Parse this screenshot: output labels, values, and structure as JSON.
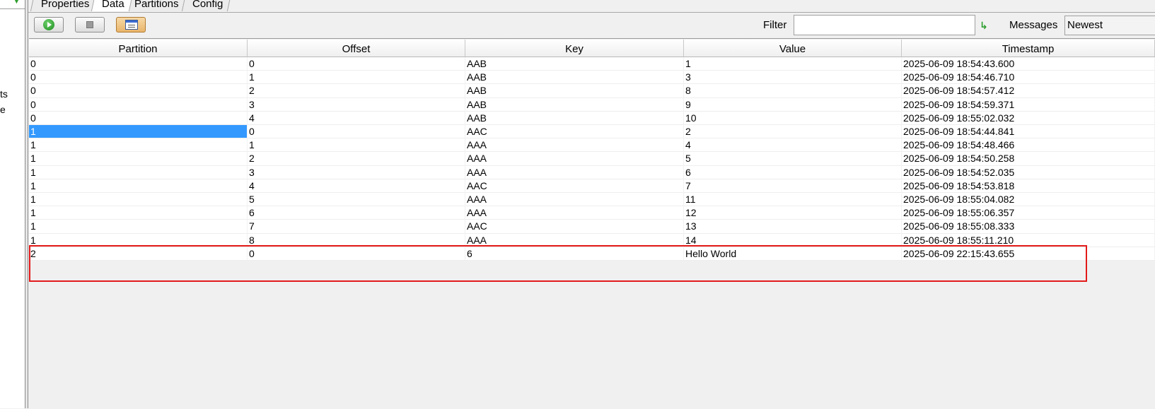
{
  "left_panel": {
    "fragments": [
      "ts",
      "e"
    ],
    "arrow_icon": "green-down-arrow-icon"
  },
  "tabs": [
    {
      "label": "Properties",
      "active": false
    },
    {
      "label": "Data",
      "active": true
    },
    {
      "label": "Partitions",
      "active": false
    },
    {
      "label": "Config",
      "active": false
    }
  ],
  "toolbar": {
    "start_icon": "play-icon",
    "stop_icon": "stop-icon",
    "view_icon": "window-icon",
    "filter_label": "Filter",
    "filter_value": "",
    "filter_apply_icon": "green-arrow-icon",
    "messages_label": "Messages",
    "messages_option": "Newest"
  },
  "table": {
    "columns": [
      "Partition",
      "Offset",
      "Key",
      "Value",
      "Timestamp"
    ],
    "rows": [
      [
        "0",
        "0",
        "AAB",
        "1",
        "2025-06-09 18:54:43.600"
      ],
      [
        "0",
        "1",
        "AAB",
        "3",
        "2025-06-09 18:54:46.710"
      ],
      [
        "0",
        "2",
        "AAB",
        "8",
        "2025-06-09 18:54:57.412"
      ],
      [
        "0",
        "3",
        "AAB",
        "9",
        "2025-06-09 18:54:59.371"
      ],
      [
        "0",
        "4",
        "AAB",
        "10",
        "2025-06-09 18:55:02.032"
      ],
      [
        "1",
        "0",
        "AAC",
        "2",
        "2025-06-09 18:54:44.841"
      ],
      [
        "1",
        "1",
        "AAA",
        "4",
        "2025-06-09 18:54:48.466"
      ],
      [
        "1",
        "2",
        "AAA",
        "5",
        "2025-06-09 18:54:50.258"
      ],
      [
        "1",
        "3",
        "AAA",
        "6",
        "2025-06-09 18:54:52.035"
      ],
      [
        "1",
        "4",
        "AAC",
        "7",
        "2025-06-09 18:54:53.818"
      ],
      [
        "1",
        "5",
        "AAA",
        "11",
        "2025-06-09 18:55:04.082"
      ],
      [
        "1",
        "6",
        "AAA",
        "12",
        "2025-06-09 18:55:06.357"
      ],
      [
        "1",
        "7",
        "AAC",
        "13",
        "2025-06-09 18:55:08.333"
      ],
      [
        "1",
        "8",
        "AAA",
        "14",
        "2025-06-09 18:55:11.210"
      ],
      [
        "2",
        "0",
        "6",
        "Hello World",
        "2025-06-09 22:15:43.655"
      ]
    ],
    "selected_row": 5,
    "selected_col": 0,
    "highlighted_row": 14,
    "highlight_color": "#e31a1a",
    "selection_color": "#3399ff"
  }
}
